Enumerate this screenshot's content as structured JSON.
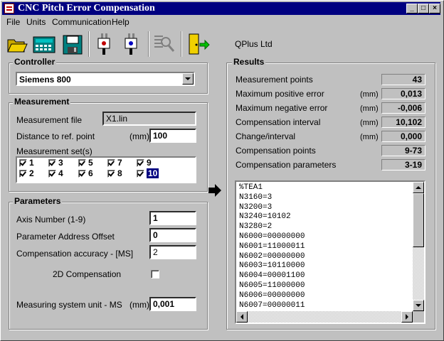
{
  "window": {
    "title": "CNC Pitch Error Compensation"
  },
  "menu": {
    "file": "File",
    "units": "Units",
    "communication": "Communication",
    "help": "Help"
  },
  "toolbar": {
    "company": "QPlus Ltd"
  },
  "controller": {
    "group_label": "Controller",
    "selected": "Siemens 800"
  },
  "measurement": {
    "group_label": "Measurement",
    "file_label": "Measurement file",
    "file_value": "X1.lin",
    "distance_label": "Distance to ref. point",
    "distance_unit": "(mm)",
    "distance_value": "100",
    "sets_label": "Measurement set(s)",
    "sets": [
      {
        "label": "1",
        "checked": true
      },
      {
        "label": "3",
        "checked": true
      },
      {
        "label": "5",
        "checked": true
      },
      {
        "label": "7",
        "checked": true
      },
      {
        "label": "9",
        "checked": true
      },
      {
        "label": "2",
        "checked": true
      },
      {
        "label": "4",
        "checked": true
      },
      {
        "label": "6",
        "checked": true
      },
      {
        "label": "8",
        "checked": true
      },
      {
        "label": "10",
        "checked": true
      }
    ]
  },
  "parameters": {
    "group_label": "Parameters",
    "axis_label": "Axis Number (1-9)",
    "axis_value": "1",
    "offset_label": "Parameter Address Offset",
    "offset_value": "0",
    "accuracy_label": "Compensation accuracy - [MS]",
    "accuracy_value": "2",
    "comp2d_label": "2D Compensation",
    "comp2d_checked": false,
    "ms_label": "Measuring system unit - MS",
    "ms_unit": "(mm)",
    "ms_value": "0,001"
  },
  "results": {
    "group_label": "Results",
    "rows": [
      {
        "label": "Measurement points",
        "unit": "",
        "value": "43"
      },
      {
        "label": "Maximum positive error",
        "unit": "(mm)",
        "value": "0,013"
      },
      {
        "label": "Maximum negative error",
        "unit": "(mm)",
        "value": "-0,006"
      },
      {
        "label": "Compensation interval",
        "unit": "(mm)",
        "value": "10,102"
      },
      {
        "label": "Change/interval",
        "unit": "(mm)",
        "value": "0,000"
      },
      {
        "label": "Compensation points",
        "unit": "",
        "value": "9-73"
      },
      {
        "label": "Compensation parameters",
        "unit": "",
        "value": "3-19"
      }
    ],
    "code": [
      "%TEA1",
      "N3160=3",
      "N3200=3",
      "N3240=10102",
      "N3280=2",
      "N6000=00000000",
      "N6001=11000011",
      "N6002=00000000",
      "N6003=10110000",
      "N6004=00001100",
      "N6005=11000000",
      "N6006=00000000",
      "N6007=00000011"
    ]
  }
}
